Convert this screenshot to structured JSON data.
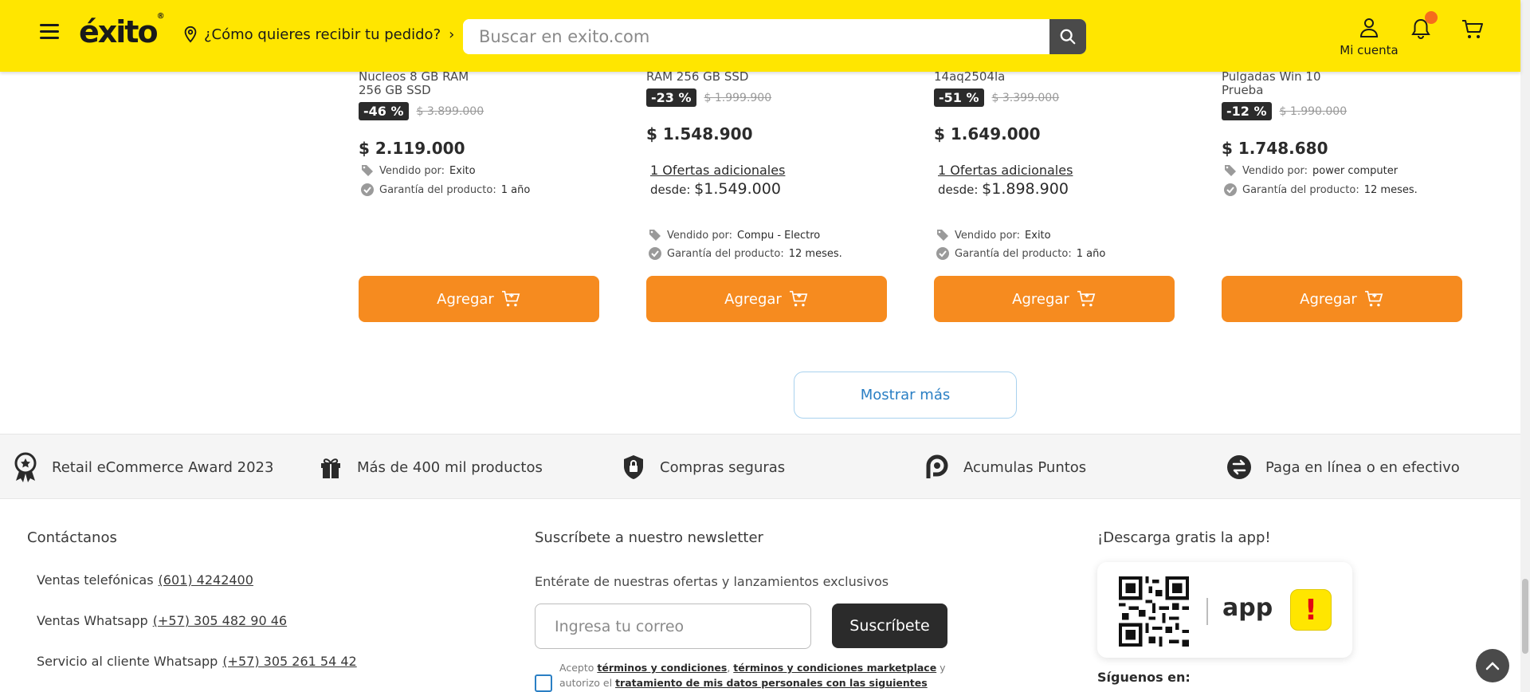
{
  "header": {
    "logo": "éxito",
    "delivery_text": "¿Cómo quieres recibir tu pedido?",
    "search_placeholder": "Buscar en exito.com",
    "account_label": "Mi cuenta"
  },
  "products": [
    {
      "name_lines": [
        "Nucleos 8 GB RAM",
        "256 GB SSD"
      ],
      "discount": "-46 %",
      "old_price": "$ 3.899.000",
      "price": "$ 2.119.000",
      "seller_label": "Vendido por:",
      "seller": "Exito",
      "warranty_label": "Garantía del producto:",
      "warranty": "1 año",
      "add_label": "Agregar"
    },
    {
      "name_lines": [
        "RAM 256 GB SSD"
      ],
      "discount": "-23 %",
      "old_price": "$ 1.999.900",
      "price": "$ 1.548.900",
      "offers": "1 Ofertas adicionales",
      "desde_label": "desde:",
      "desde_value": "$1.549.000",
      "seller_label": "Vendido por:",
      "seller": "Compu - Electro",
      "warranty_label": "Garantía del producto:",
      "warranty": "12 meses.",
      "add_label": "Agregar"
    },
    {
      "name_lines": [
        "14aq2504la"
      ],
      "discount": "-51 %",
      "old_price": "$ 3.399.000",
      "price": "$ 1.649.000",
      "offers": "1 Ofertas adicionales",
      "desde_label": "desde:",
      "desde_value": "$1.898.900",
      "seller_label": "Vendido por:",
      "seller": "Exito",
      "warranty_label": "Garantía del producto:",
      "warranty": "1 año",
      "add_label": "Agregar"
    },
    {
      "name_lines": [
        "Pulgadas Win 10",
        "Prueba"
      ],
      "discount": "-12 %",
      "old_price": "$ 1.990.000",
      "price": "$ 1.748.680",
      "seller_label": "Vendido por:",
      "seller": "power computer",
      "warranty_label": "Garantía del producto:",
      "warranty": "12 meses.",
      "add_label": "Agregar"
    }
  ],
  "show_more": "Mostrar más",
  "benefits": [
    {
      "icon": "award-icon",
      "label": "Retail eCommerce Award 2023"
    },
    {
      "icon": "gift-icon",
      "label": "Más de 400 mil productos"
    },
    {
      "icon": "shield-lock-icon",
      "label": "Compras seguras"
    },
    {
      "icon": "points-icon",
      "label": "Acumulas Puntos"
    },
    {
      "icon": "exchange-icon",
      "label": "Paga en línea o en efectivo"
    }
  ],
  "footer": {
    "contact_title": "Contáctanos",
    "contacts": [
      {
        "label": "Ventas telefónicas",
        "value": "(601) 4242400"
      },
      {
        "label": "Ventas Whatsapp",
        "value": "(+57) 305 482 90 46"
      },
      {
        "label": "Servicio al cliente Whatsapp",
        "value": "(+57) 305 261 54 42"
      }
    ],
    "newsletter_title": "Suscríbete a nuestro newsletter",
    "newsletter_desc": "Entérate de nuestras ofertas y lanzamientos exclusivos",
    "email_placeholder": "Ingresa tu correo",
    "subscribe_label": "Suscríbete",
    "terms": {
      "t1": "Acepto",
      "l1": "términos y condiciones",
      "comma": ",",
      "l2": "términos y condiciones marketplace",
      "t2": "y",
      "t3": "autorizo el",
      "l3": "tratamiento de mis datos personales con las siguientes"
    },
    "app_title": "¡Descarga gratis la app!",
    "app_word": "app",
    "follow": "Síguenos en:"
  },
  "colors": {
    "header_bg": "#ffe600",
    "accent_orange": "#f68b1f",
    "link_blue": "#2a7fc4",
    "discount_bg": "#2b2b2b"
  }
}
